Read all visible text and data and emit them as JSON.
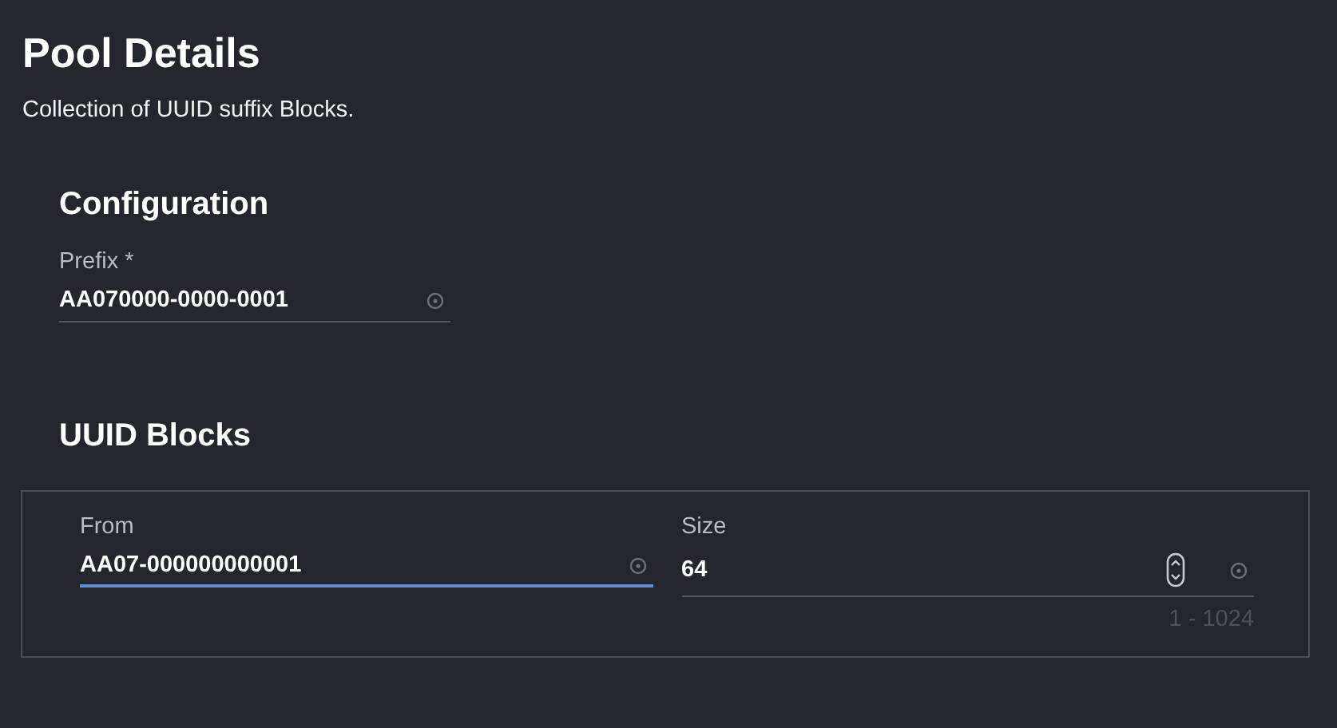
{
  "page": {
    "title": "Pool Details",
    "description": "Collection of UUID suffix Blocks."
  },
  "configuration": {
    "heading": "Configuration",
    "fields": [
      {
        "kind": "text",
        "label": "Prefix *",
        "value": "AA070000-0000-0001",
        "focused": false
      }
    ]
  },
  "uuid_blocks": {
    "heading": "UUID Blocks",
    "fields": [
      {
        "kind": "text",
        "label": "From",
        "value": "AA07-000000000001",
        "focused": true
      },
      {
        "kind": "number",
        "label": "Size",
        "value": "64",
        "focused": false,
        "hint": "1 - 1024"
      }
    ]
  }
}
